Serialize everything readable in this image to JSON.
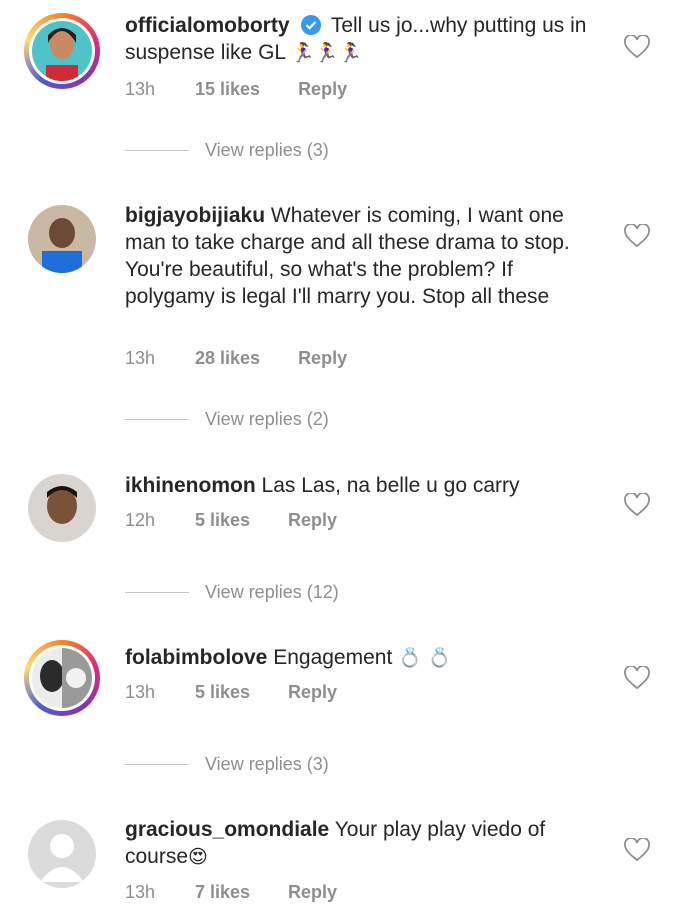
{
  "comments": [
    {
      "username": "officialomoborty",
      "verified": true,
      "text": "Tell us jo...why putting us in suspense like GL",
      "emoji": "🏃‍♀️🏃‍♀️🏃‍♀️",
      "time": "13h",
      "likes": "15 likes",
      "reply": "Reply",
      "view_replies": "View replies (3)"
    },
    {
      "username": "bigjayobijiaku",
      "text": "Whatever is coming, I want one man to take charge and all these drama to stop. You're beautiful, so what's the problem? If polygamy is legal I'll marry you. Stop all these",
      "time": "13h",
      "likes": "28 likes",
      "reply": "Reply",
      "view_replies": "View replies (2)"
    },
    {
      "username": "ikhinenomon",
      "text": "Las Las, na belle u go carry",
      "time": "12h",
      "likes": "5 likes",
      "reply": "Reply",
      "view_replies": "View replies (12)"
    },
    {
      "username": "folabimbolove",
      "text": "Engagement",
      "emoji": "💍 💍",
      "time": "13h",
      "likes": "5 likes",
      "reply": "Reply",
      "view_replies": "View replies (3)"
    },
    {
      "username": "gracious_omondiale",
      "text": "Your play play viedo of course",
      "emoji": "😍",
      "time": "13h",
      "likes": "7 likes",
      "reply": "Reply"
    }
  ],
  "colors": {
    "verified": "#3897f0",
    "meta": "#8e8e8e",
    "text": "#262626"
  }
}
